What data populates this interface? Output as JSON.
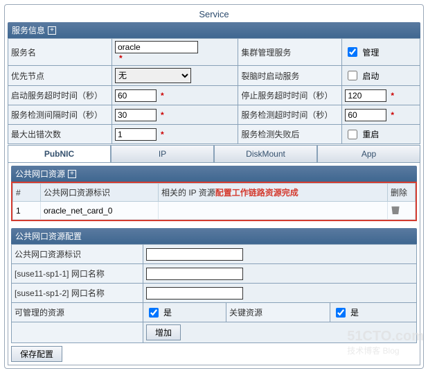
{
  "title": "Service",
  "sections": {
    "serviceInfo": "服务信息",
    "pubNicRes": "公共网口资源",
    "pubNicCfg": "公共网口资源配置"
  },
  "form": {
    "serviceName": {
      "label": "服务名",
      "value": "oracle"
    },
    "clusterMgmt": {
      "label": "集群管理服务",
      "chkLabel": "管理",
      "checked": true
    },
    "priorityNode": {
      "label": "优先节点",
      "selected": "无"
    },
    "splitStart": {
      "label": "裂脑时启动服务",
      "chkLabel": "启动",
      "checked": false
    },
    "startTimeout": {
      "label": "启动服务超时时间（秒）",
      "value": "60"
    },
    "stopTimeout": {
      "label": "停止服务超时时间（秒）",
      "value": "120"
    },
    "checkInterval": {
      "label": "服务检测间隔时间（秒）",
      "value": "30"
    },
    "checkTimeout": {
      "label": "服务检测超时时间（秒）",
      "value": "60"
    },
    "maxErrors": {
      "label": "最大出错次数",
      "value": "1"
    },
    "afterFail": {
      "label": "服务检测失败后",
      "chkLabel": "重启",
      "checked": false
    }
  },
  "tabs": [
    {
      "id": "pubnic",
      "label": "PubNIC",
      "active": true
    },
    {
      "id": "ip",
      "label": "IP"
    },
    {
      "id": "diskmount",
      "label": "DiskMount"
    },
    {
      "id": "app",
      "label": "App"
    }
  ],
  "listHeaders": {
    "idx": "#",
    "resId": "公共网口资源标识",
    "relIp": "相关的 IP 资源",
    "del": "删除"
  },
  "listRows": [
    {
      "idx": "1",
      "resId": "oracle_net_card_0",
      "relIp": ""
    }
  ],
  "overlayNote": "配置工作链路资源完成",
  "cfg": {
    "resId": {
      "label": "公共网口资源标识",
      "value": ""
    },
    "nic1": {
      "label": "[suse11-sp1-1] 网口名称",
      "value": ""
    },
    "nic2": {
      "label": "[suse11-sp1-2] 网口名称",
      "value": ""
    },
    "manageable": {
      "label": "可管理的资源",
      "chkLabel": "是",
      "checked": true
    },
    "critical": {
      "label": "关键资源",
      "chkLabel": "是",
      "checked": true
    }
  },
  "buttons": {
    "add": "增加",
    "save": "保存配置"
  },
  "watermark": {
    "main": "51CTO.com",
    "sub": "技术博客         Blog"
  }
}
